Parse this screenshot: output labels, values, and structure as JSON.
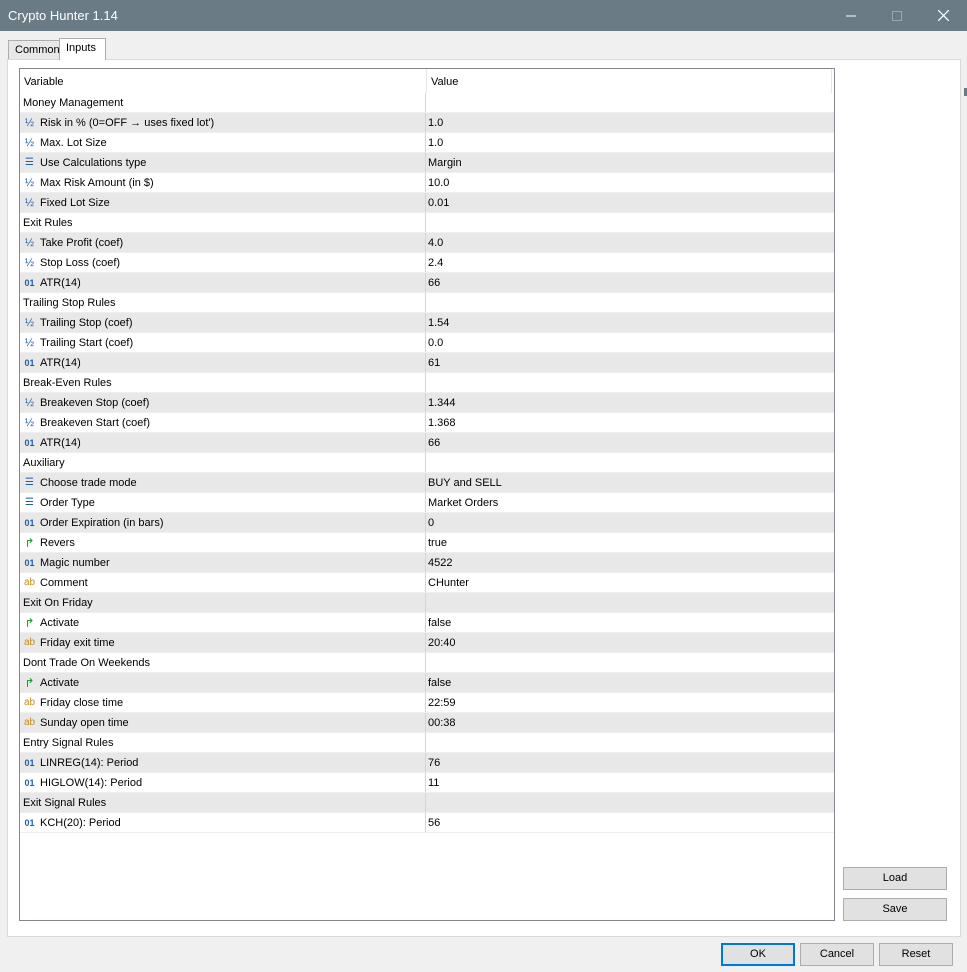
{
  "window": {
    "title": "Crypto Hunter 1.14"
  },
  "tabs": [
    {
      "label": "Common"
    },
    {
      "label": "Inputs"
    }
  ],
  "table": {
    "headers": {
      "variable": "Variable",
      "value": "Value"
    },
    "rows": [
      {
        "type": "group",
        "variable": "Money Management",
        "value": ""
      },
      {
        "type": "double",
        "icon": "half-icon",
        "glyph": "½",
        "variable": "Risk in % (0=OFF → uses fixed lot')",
        "value": "1.0"
      },
      {
        "type": "double",
        "icon": "half-icon",
        "glyph": "½",
        "variable": "Max. Lot Size",
        "value": "1.0"
      },
      {
        "type": "enum",
        "icon": "enum-icon",
        "glyph": "☰",
        "variable": "Use Calculations type",
        "value": "Margin"
      },
      {
        "type": "double",
        "icon": "half-icon",
        "glyph": "½",
        "variable": "Max Risk Amount (in $)",
        "value": "10.0"
      },
      {
        "type": "double",
        "icon": "half-icon",
        "glyph": "½",
        "variable": "Fixed Lot Size",
        "value": "0.01"
      },
      {
        "type": "group",
        "variable": "Exit Rules",
        "value": ""
      },
      {
        "type": "double",
        "icon": "half-icon",
        "glyph": "½",
        "variable": "Take Profit (coef)",
        "value": "4.0"
      },
      {
        "type": "double",
        "icon": "half-icon",
        "glyph": "½",
        "variable": "Stop Loss (coef)",
        "value": "2.4"
      },
      {
        "type": "int",
        "icon": "int-icon",
        "glyph": "01",
        "variable": "ATR(14)",
        "value": "66"
      },
      {
        "type": "group",
        "variable": "Trailing Stop Rules",
        "value": ""
      },
      {
        "type": "double",
        "icon": "half-icon",
        "glyph": "½",
        "variable": "Trailing Stop  (coef)",
        "value": "1.54"
      },
      {
        "type": "double",
        "icon": "half-icon",
        "glyph": "½",
        "variable": "Trailing Start (coef)",
        "value": "0.0"
      },
      {
        "type": "int",
        "icon": "int-icon",
        "glyph": "01",
        "variable": "ATR(14)",
        "value": "61"
      },
      {
        "type": "group",
        "variable": "Break-Even Rules",
        "value": ""
      },
      {
        "type": "double",
        "icon": "half-icon",
        "glyph": "½",
        "variable": "Breakeven Stop  (coef)",
        "value": "1.344"
      },
      {
        "type": "double",
        "icon": "half-icon",
        "glyph": "½",
        "variable": "Breakeven Start (coef)",
        "value": "1.368"
      },
      {
        "type": "int",
        "icon": "int-icon",
        "glyph": "01",
        "variable": "ATR(14)",
        "value": "66"
      },
      {
        "type": "group",
        "variable": "Auxiliary",
        "value": ""
      },
      {
        "type": "enum",
        "icon": "enum-icon",
        "glyph": "☰",
        "variable": "Choose trade mode",
        "value": "BUY and SELL"
      },
      {
        "type": "enum",
        "icon": "enum-icon",
        "glyph": "☰",
        "variable": "Order Type",
        "value": "Market Orders"
      },
      {
        "type": "int",
        "icon": "int-icon",
        "glyph": "01",
        "variable": "Order Expiration (in bars)",
        "value": "0"
      },
      {
        "type": "bool",
        "icon": "bool-icon",
        "glyph": "↱",
        "variable": "Revers",
        "value": "true"
      },
      {
        "type": "int",
        "icon": "int-icon",
        "glyph": "01",
        "variable": "Magic number",
        "value": "4522"
      },
      {
        "type": "string",
        "icon": "string-icon",
        "glyph": "ab",
        "variable": "Comment",
        "value": "CHunter"
      },
      {
        "type": "group",
        "variable": "Exit On Friday",
        "value": ""
      },
      {
        "type": "bool",
        "icon": "bool-icon",
        "glyph": "↱",
        "variable": "Activate",
        "value": "false"
      },
      {
        "type": "string",
        "icon": "string-icon",
        "glyph": "ab",
        "variable": "Friday exit time",
        "value": "20:40"
      },
      {
        "type": "group",
        "variable": "Dont Trade On Weekends",
        "value": ""
      },
      {
        "type": "bool",
        "icon": "bool-icon",
        "glyph": "↱",
        "variable": "Activate",
        "value": "false"
      },
      {
        "type": "string",
        "icon": "string-icon",
        "glyph": "ab",
        "variable": "Friday close time",
        "value": "22:59"
      },
      {
        "type": "string",
        "icon": "string-icon",
        "glyph": "ab",
        "variable": "Sunday open time",
        "value": "00:38"
      },
      {
        "type": "group",
        "variable": "Entry Signal Rules",
        "value": ""
      },
      {
        "type": "int",
        "icon": "int-icon",
        "glyph": "01",
        "variable": "LINREG(14): Period",
        "value": "76"
      },
      {
        "type": "int",
        "icon": "int-icon",
        "glyph": "01",
        "variable": "HIGLOW(14): Period",
        "value": "11"
      },
      {
        "type": "group",
        "variable": "Exit Signal Rules",
        "value": ""
      },
      {
        "type": "int",
        "icon": "int-icon",
        "glyph": "01",
        "variable": "KCH(20): Period",
        "value": "56"
      }
    ]
  },
  "side_buttons": {
    "load": "Load",
    "save": "Save"
  },
  "footer_buttons": {
    "ok": "OK",
    "cancel": "Cancel",
    "reset": "Reset"
  },
  "colors": {
    "titlebar": "#6a7b86",
    "icon_double": "#1f5fa8",
    "icon_bool": "#1a9a2c",
    "icon_string": "#c78a1a"
  }
}
